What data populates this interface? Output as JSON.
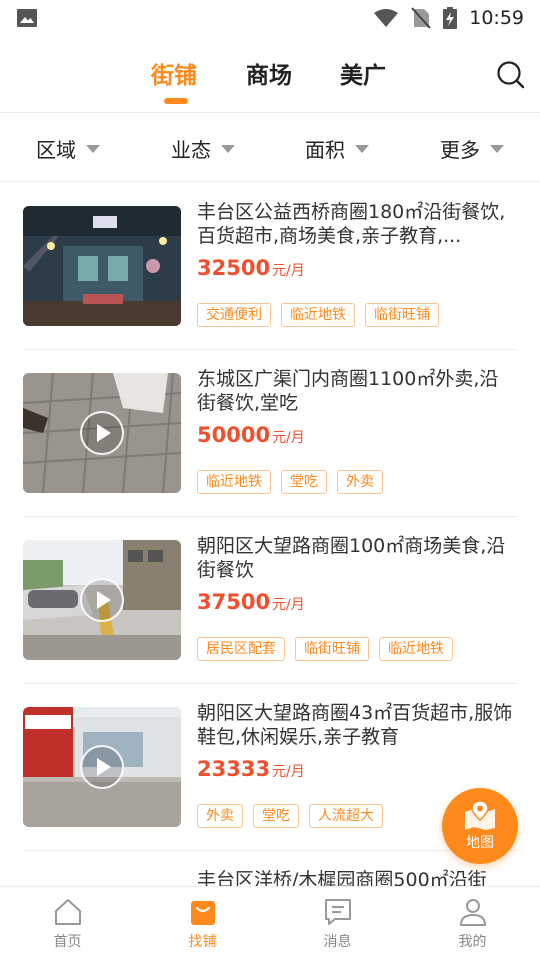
{
  "status_bar": {
    "time": "10:59"
  },
  "top_tabs": [
    {
      "label": "街铺",
      "active": true
    },
    {
      "label": "商场",
      "active": false
    },
    {
      "label": "美广",
      "active": false
    }
  ],
  "filters": [
    "区域",
    "业态",
    "面积",
    "更多"
  ],
  "listings": [
    {
      "title": "丰台区公益西桥商圈180㎡沿街餐饮,百货超市,商场美食,亲子教育,...",
      "price": "32500",
      "unit": "元/月",
      "tags": [
        "交通便利",
        "临近地铁",
        "临街旺铺"
      ],
      "has_video": false
    },
    {
      "title": "东城区广渠门内商圈1100㎡外卖,沿街餐饮,堂吃",
      "price": "50000",
      "unit": "元/月",
      "tags": [
        "临近地铁",
        "堂吃",
        "外卖"
      ],
      "has_video": true
    },
    {
      "title": "朝阳区大望路商圈100㎡商场美食,沿街餐饮",
      "price": "37500",
      "unit": "元/月",
      "tags": [
        "居民区配套",
        "临街旺铺",
        "临近地铁"
      ],
      "has_video": true
    },
    {
      "title": "朝阳区大望路商圈43㎡百货超市,服饰鞋包,休闲娱乐,亲子教育",
      "price": "23333",
      "unit": "元/月",
      "tags": [
        "外卖",
        "堂吃",
        "人流超大"
      ],
      "has_video": true
    }
  ],
  "partial_listing": {
    "title": "丰台区洋桥/木樨园商圈500㎡沿街"
  },
  "map_button": {
    "label": "地图"
  },
  "bottom_nav": [
    {
      "label": "首页",
      "icon": "home-icon",
      "active": false
    },
    {
      "label": "找铺",
      "icon": "shop-bag-icon",
      "active": true
    },
    {
      "label": "消息",
      "icon": "message-icon",
      "active": false
    },
    {
      "label": "我的",
      "icon": "profile-icon",
      "active": false
    }
  ],
  "colors": {
    "accent": "#ff8a1c",
    "price": "#f0502d",
    "tag_border": "#ffc48d"
  }
}
